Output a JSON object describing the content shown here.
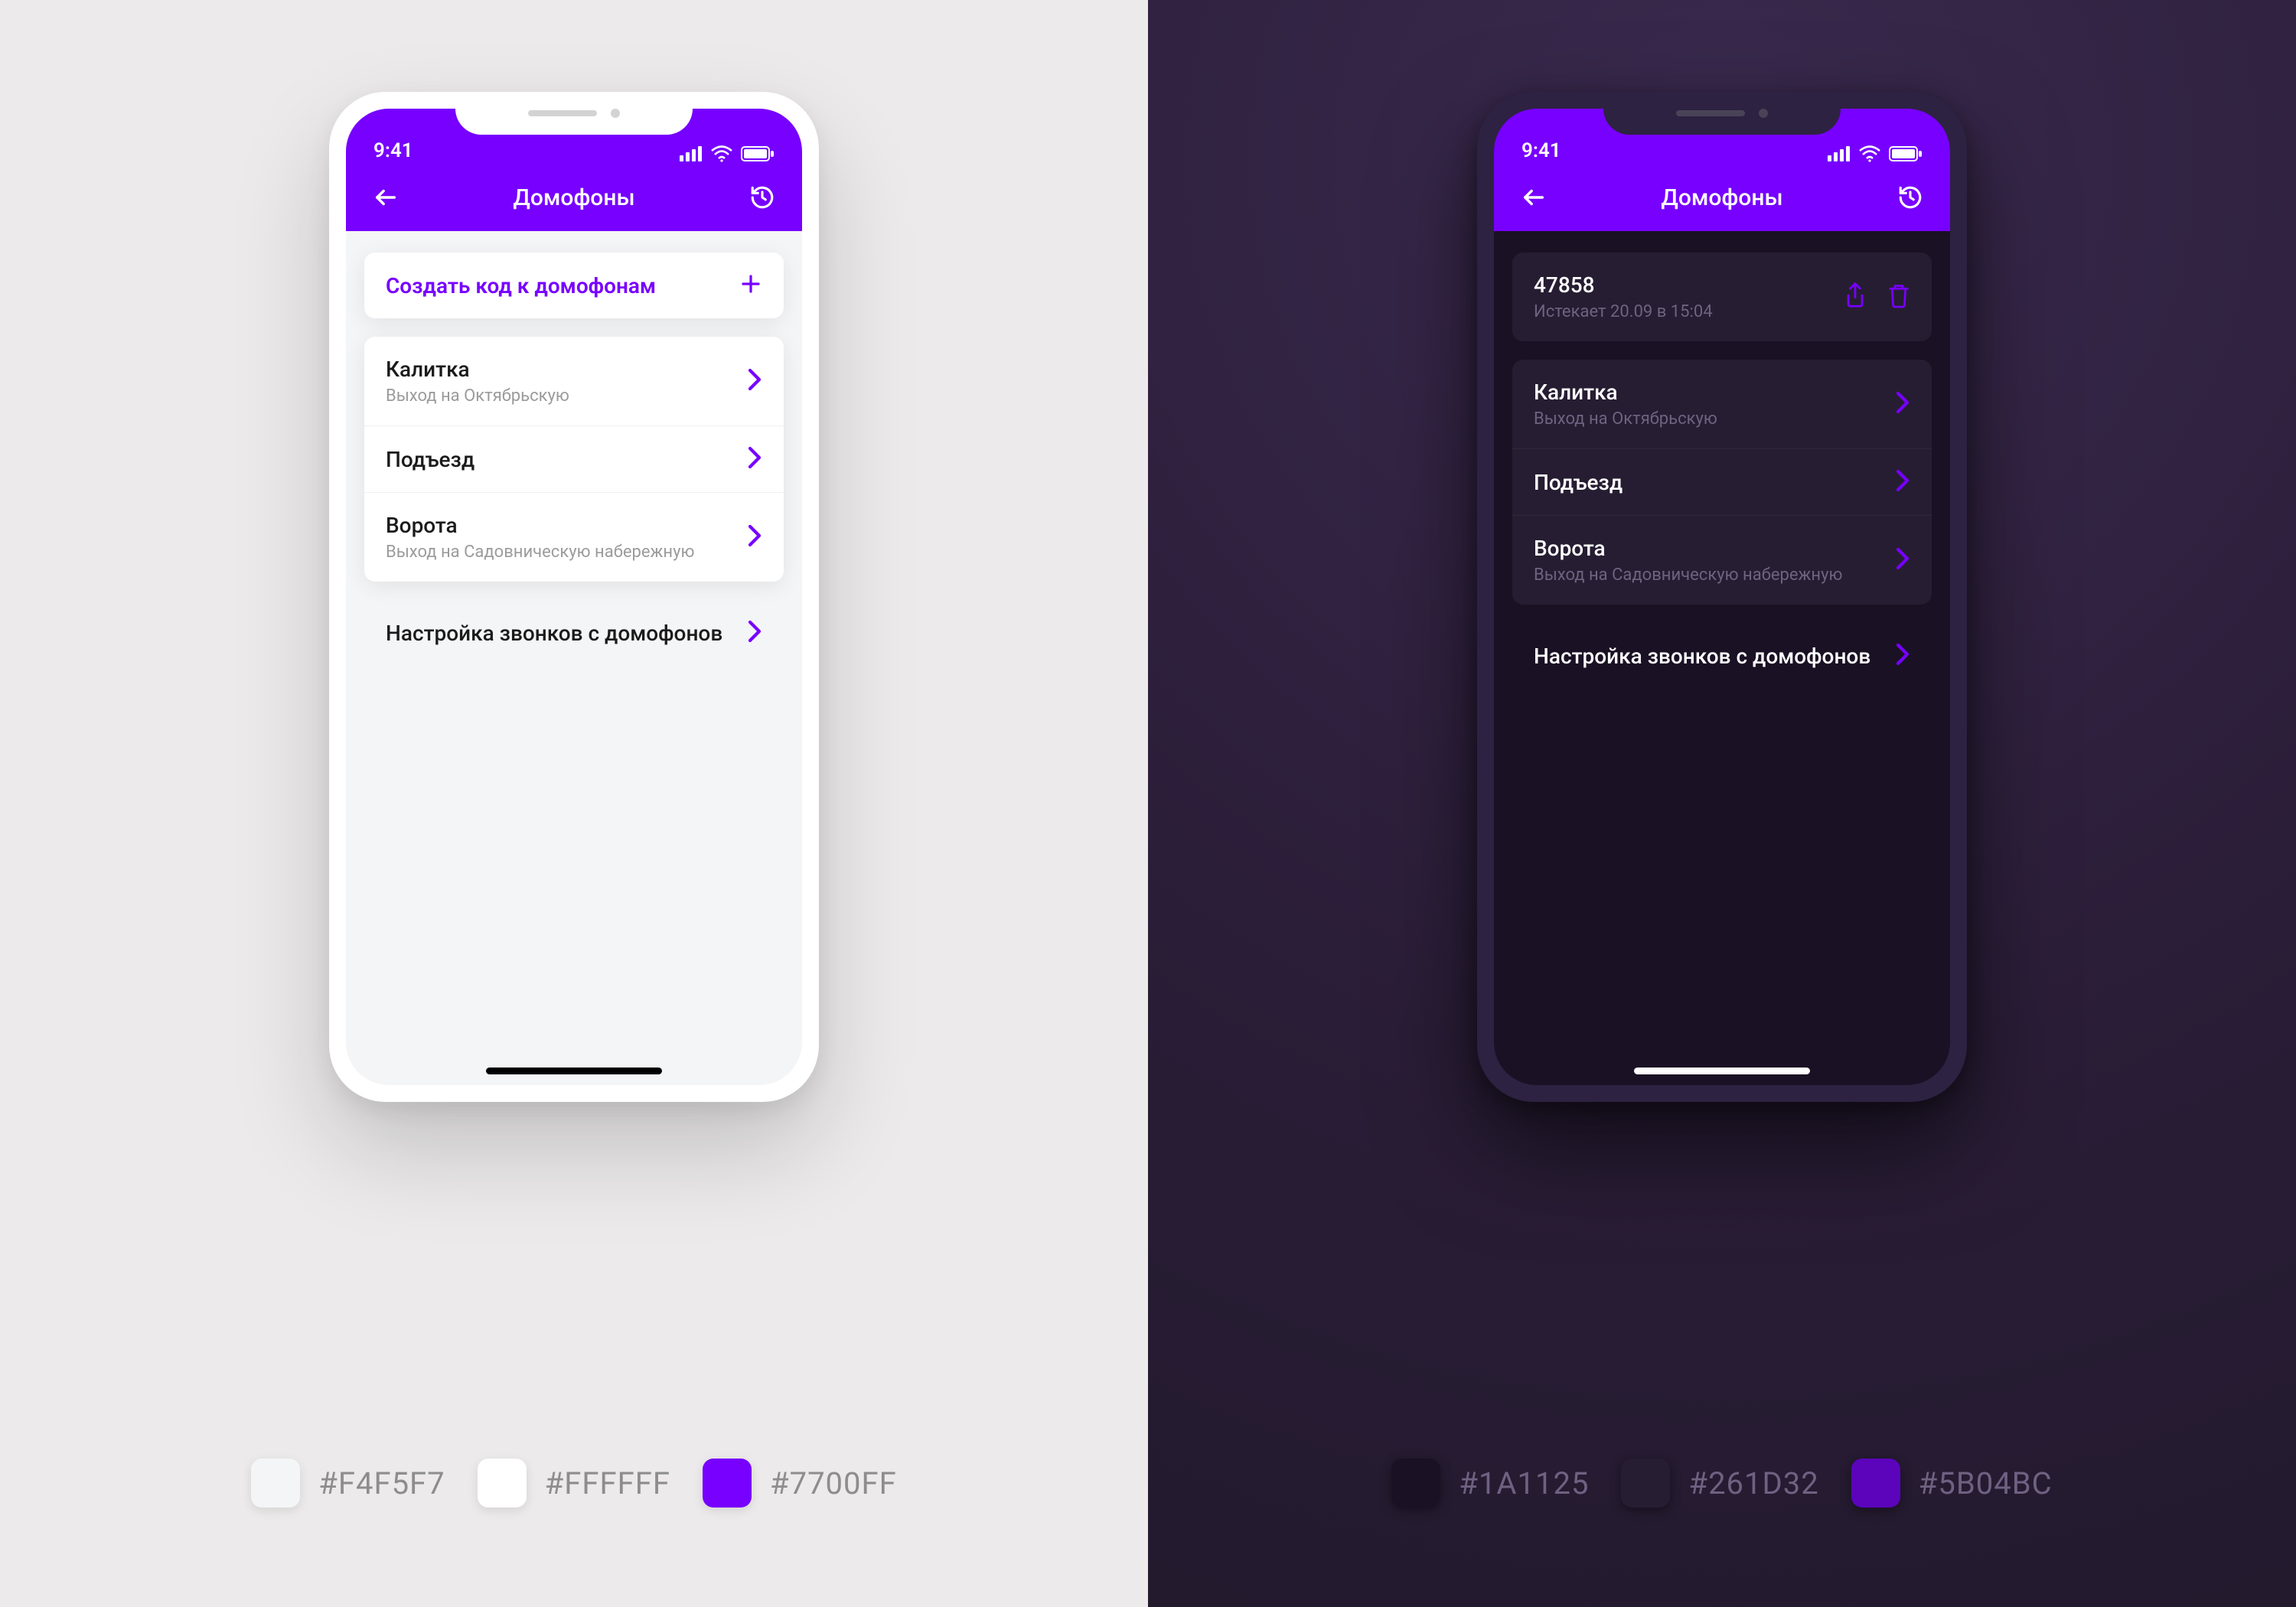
{
  "status_time": "9:41",
  "nav": {
    "title": "Домофоны"
  },
  "light": {
    "create_label": "Создать код к домофонам",
    "items": [
      {
        "title": "Калитка",
        "sub": "Выход на Октябрьскую"
      },
      {
        "title": "Подъезд",
        "sub": ""
      },
      {
        "title": "Ворота",
        "sub": "Выход на Садовническую набережную"
      }
    ],
    "settings_label": "Настройка звонков с домофонов",
    "palette": [
      {
        "hex": "#F4F5F7"
      },
      {
        "hex": "#FFFFFF"
      },
      {
        "hex": "#7700FF"
      }
    ]
  },
  "dark": {
    "code": {
      "value": "47858",
      "expires": "Истекает 20.09 в 15:04"
    },
    "items": [
      {
        "title": "Калитка",
        "sub": "Выход на Октябрьскую"
      },
      {
        "title": "Подъезд",
        "sub": ""
      },
      {
        "title": "Ворота",
        "sub": "Выход на Садовническую набережную"
      }
    ],
    "settings_label": "Настройка звонков с домофонов",
    "palette": [
      {
        "hex": "#1A1125"
      },
      {
        "hex": "#261D32"
      },
      {
        "hex": "#5B04BC"
      }
    ]
  }
}
